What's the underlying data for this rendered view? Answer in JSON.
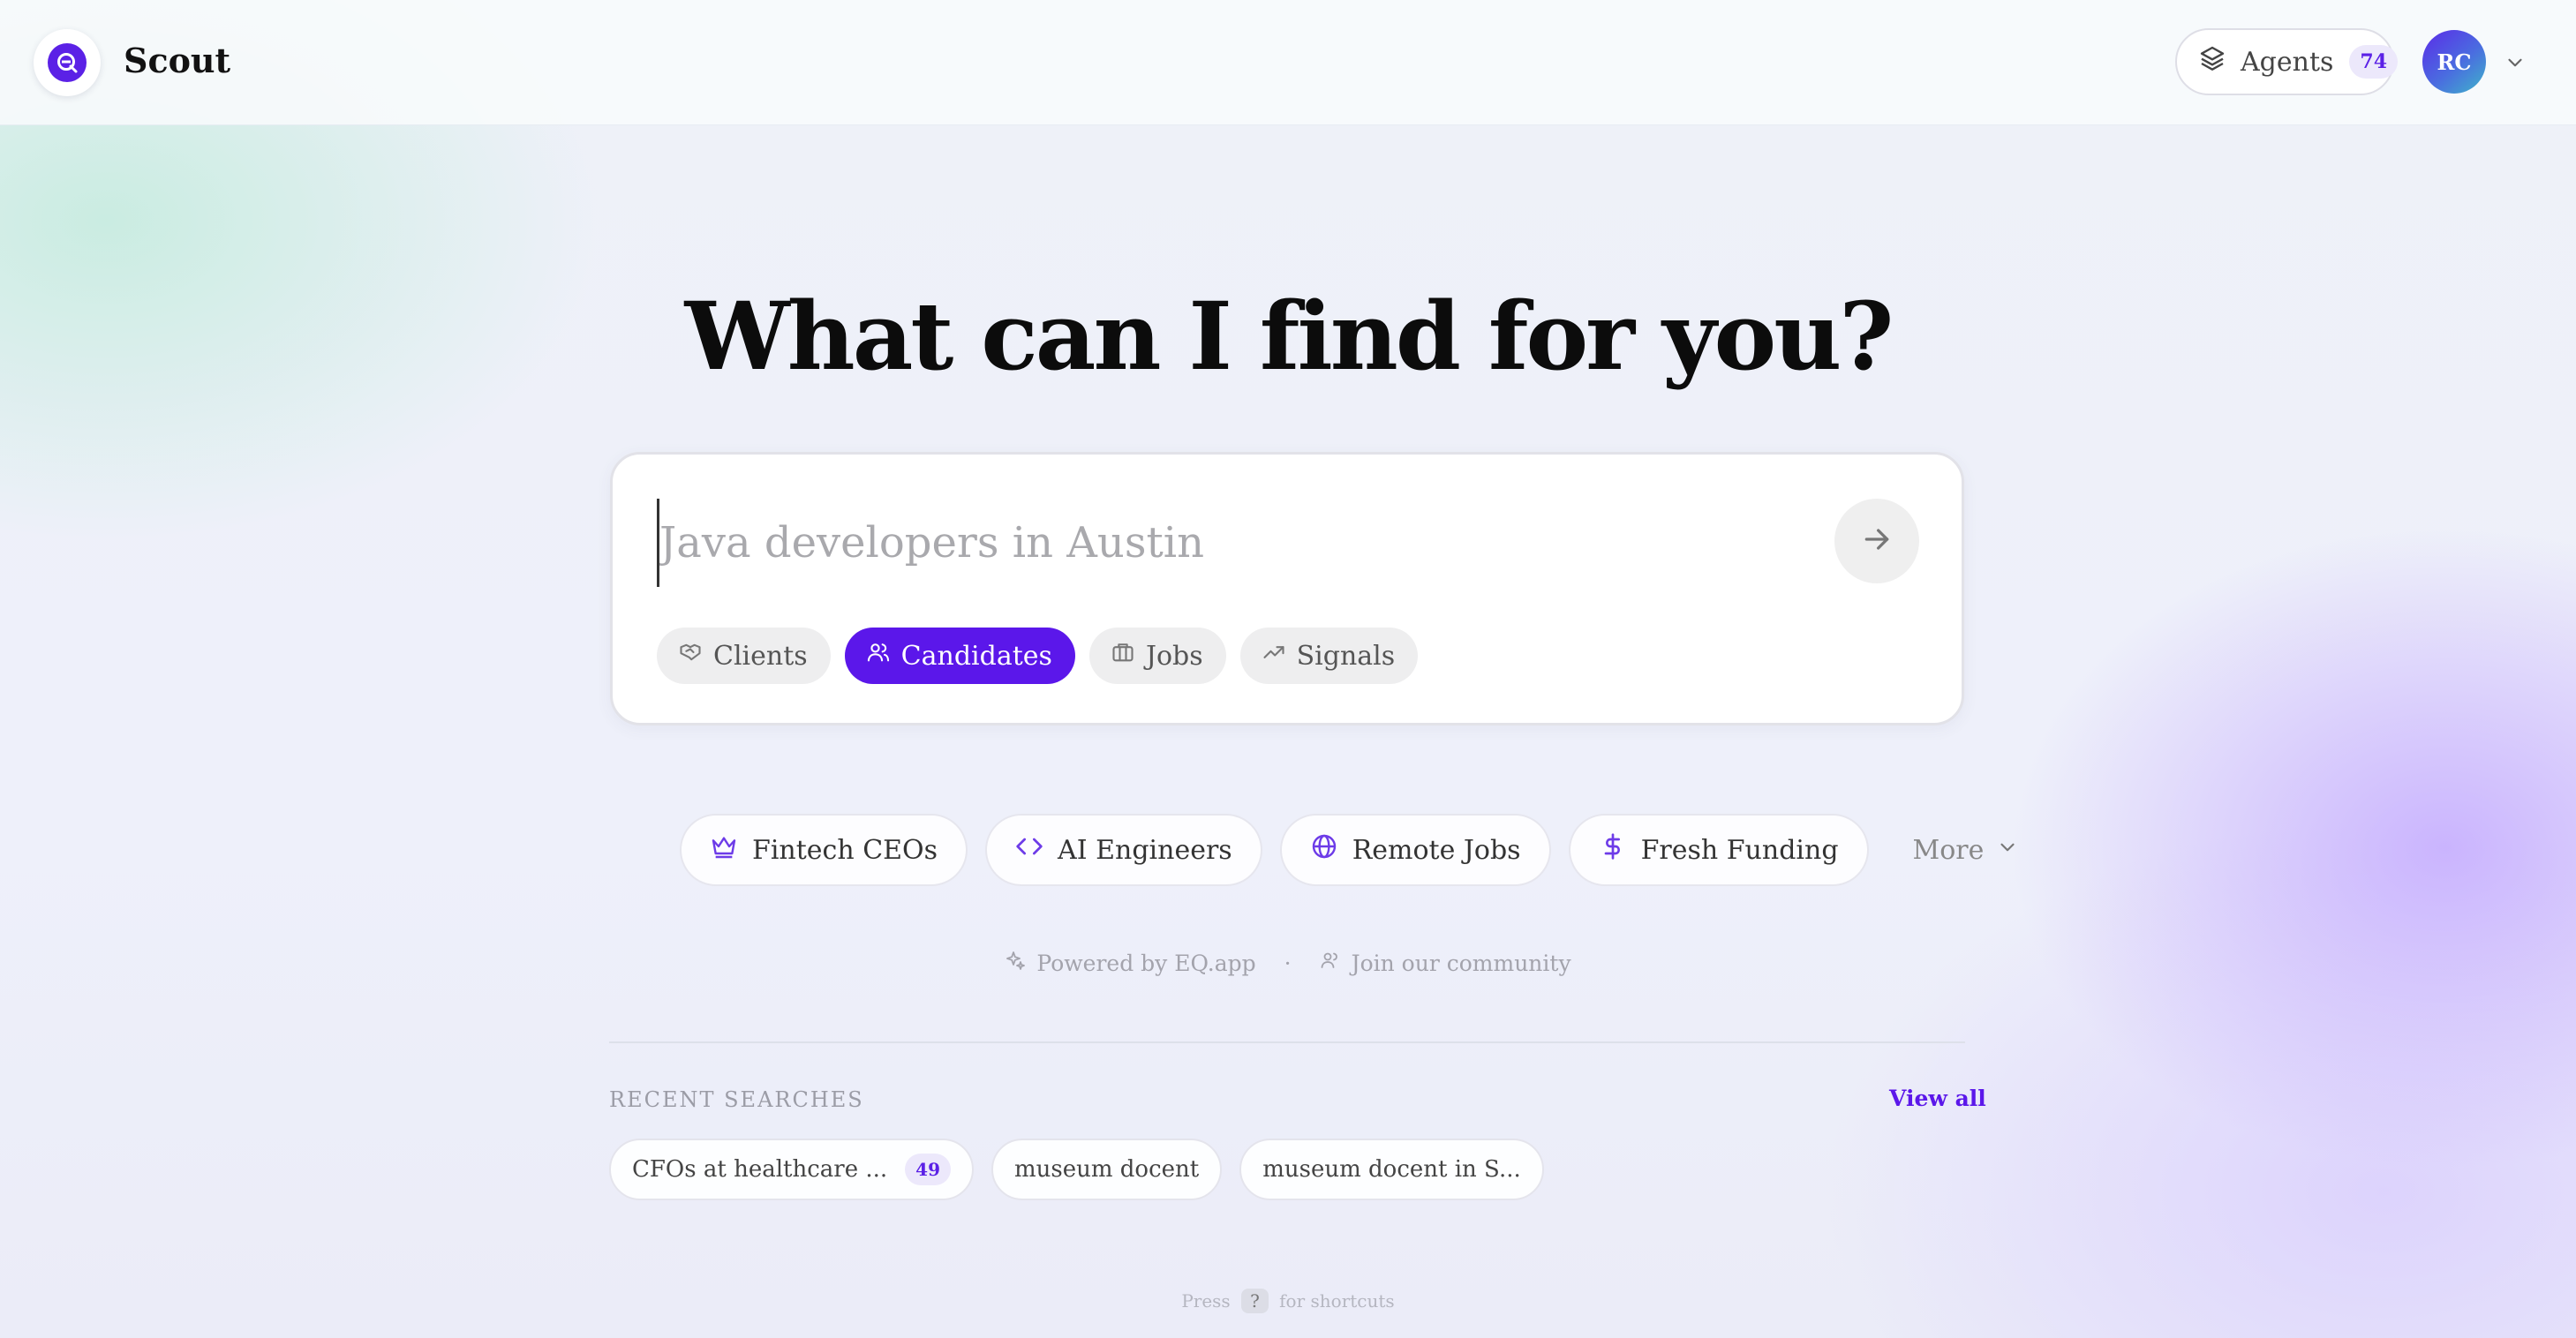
{
  "header": {
    "app_name": "Scout",
    "agents_label": "Agents",
    "agents_count": "74",
    "avatar_initials": "RC"
  },
  "main": {
    "headline": "What can I find for you?",
    "search": {
      "placeholder": "Java developers in Austin",
      "value": ""
    },
    "chips": [
      {
        "label": "Clients",
        "icon": "handshake-icon",
        "active": false
      },
      {
        "label": "Candidates",
        "icon": "users-icon",
        "active": true
      },
      {
        "label": "Jobs",
        "icon": "briefcase-icon",
        "active": false
      },
      {
        "label": "Signals",
        "icon": "trending-up-icon",
        "active": false
      }
    ],
    "suggestions": [
      {
        "label": "Fintech CEOs",
        "icon": "crown-icon"
      },
      {
        "label": "AI Engineers",
        "icon": "code-icon"
      },
      {
        "label": "Remote Jobs",
        "icon": "globe-icon"
      },
      {
        "label": "Fresh Funding",
        "icon": "dollar-icon"
      }
    ],
    "more_label": "More",
    "powered_by": "Powered by EQ.app",
    "separator": "·",
    "community": "Join our community"
  },
  "recent": {
    "title": "RECENT SEARCHES",
    "view_all": "View all",
    "items": [
      {
        "label": "CFOs at healthcare ...",
        "count": "49"
      },
      {
        "label": "museum docent",
        "count": ""
      },
      {
        "label": "museum docent in S...",
        "count": ""
      }
    ]
  },
  "footer": {
    "press": "Press",
    "key": "?",
    "suffix": "for shortcuts"
  },
  "colors": {
    "accent": "#5b17ea",
    "accent_soft": "#ece8fb"
  }
}
